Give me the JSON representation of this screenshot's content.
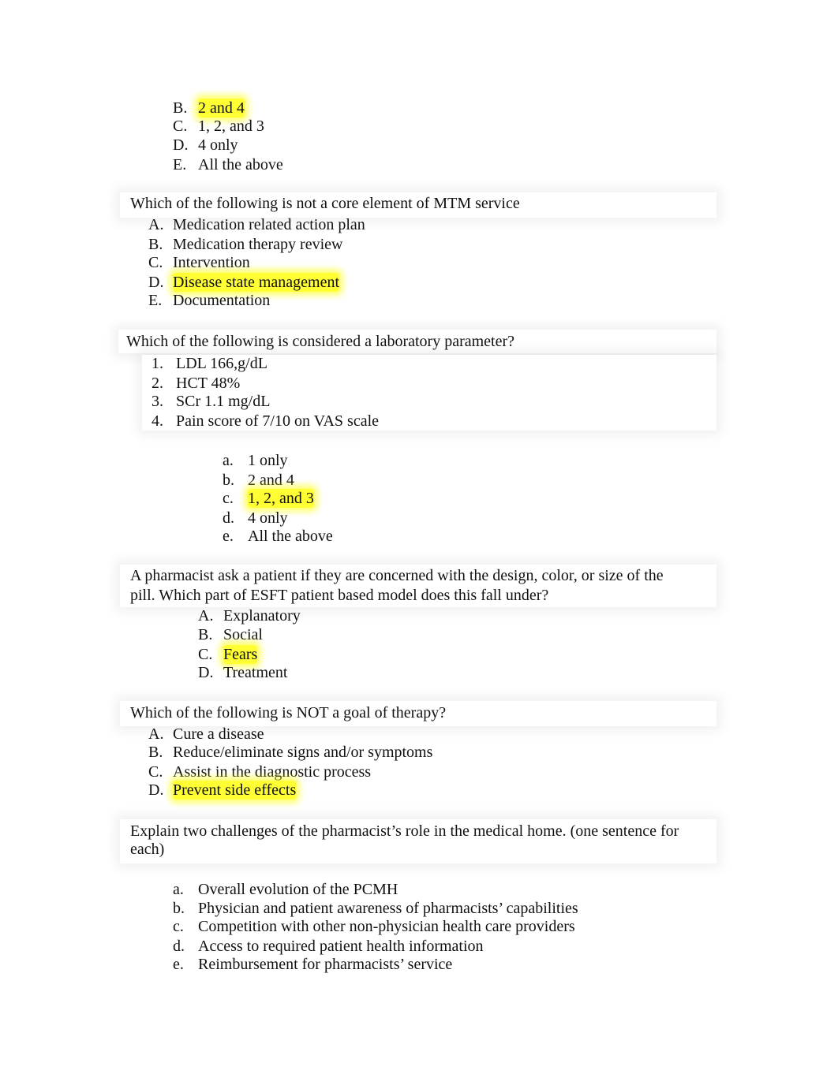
{
  "highlight_color": "#ffff33",
  "q0": {
    "options": [
      {
        "marker": "B.",
        "text": "2 and 4",
        "highlighted": true
      },
      {
        "marker": "C.",
        "text": "1, 2, and 3"
      },
      {
        "marker": "D.",
        "text": "4 only"
      },
      {
        "marker": "E.",
        "text": "All the above"
      }
    ]
  },
  "q1": {
    "question": "Which of the following is not a core element of MTM service",
    "options": [
      {
        "marker": "A.",
        "text": "Medication related action plan"
      },
      {
        "marker": "B.",
        "text": "Medication therapy review"
      },
      {
        "marker": "C.",
        "text": "Intervention"
      },
      {
        "marker": "D.",
        "text": "Disease state management",
        "highlighted": true
      },
      {
        "marker": "E.",
        "text": "Documentation"
      }
    ]
  },
  "q2": {
    "question": "Which of the following is considered a laboratory parameter?",
    "items": [
      {
        "marker": "1.",
        "text": "LDL 166,g/dL"
      },
      {
        "marker": "2.",
        "text": "HCT 48%"
      },
      {
        "marker": "3.",
        "text": "SCr 1.1 mg/dL"
      },
      {
        "marker": "4.",
        "text": "Pain score of 7/10 on VAS scale"
      }
    ],
    "options": [
      {
        "marker": "a.",
        "text": "1 only"
      },
      {
        "marker": "b.",
        "text": "2 and 4"
      },
      {
        "marker": "c.",
        "text": "1, 2, and 3",
        "highlighted": true
      },
      {
        "marker": "d.",
        "text": "4 only"
      },
      {
        "marker": "e.",
        "text": "All the above"
      }
    ]
  },
  "q3": {
    "question_line1": "A pharmacist ask a patient if they are concerned with the design, color, or size of the",
    "question_line2": "pill. Which part of ESFT patient based model does this fall under?",
    "options": [
      {
        "marker": "A.",
        "text": "Explanatory"
      },
      {
        "marker": "B.",
        "text": "Social"
      },
      {
        "marker": "C.",
        "text": "Fears",
        "highlighted": true
      },
      {
        "marker": "D.",
        "text": "Treatment"
      }
    ]
  },
  "q4": {
    "question": "Which of the following is NOT a goal of therapy?",
    "options": [
      {
        "marker": "A.",
        "text": "Cure a disease"
      },
      {
        "marker": "B.",
        "text": "Reduce/eliminate signs and/or symptoms"
      },
      {
        "marker": "C.",
        "text": "Assist in the diagnostic process"
      },
      {
        "marker": "D.",
        "text": "Prevent side effects",
        "highlighted": true
      }
    ]
  },
  "q5": {
    "question_line1": "Explain two challenges of the pharmacist’s role in the medical home.  (one sentence for",
    "question_line2": "each)",
    "options": [
      {
        "marker": "a.",
        "text": "Overall evolution of the PCMH"
      },
      {
        "marker": "b.",
        "text": "Physician and patient awareness of pharmacists’ capabilities"
      },
      {
        "marker": "c.",
        "text": "Competition with other non-physician health care providers"
      },
      {
        "marker": "d.",
        "text": "Access to required patient health information"
      },
      {
        "marker": "e.",
        "text": "Reimbursement for pharmacists’ service"
      }
    ]
  }
}
